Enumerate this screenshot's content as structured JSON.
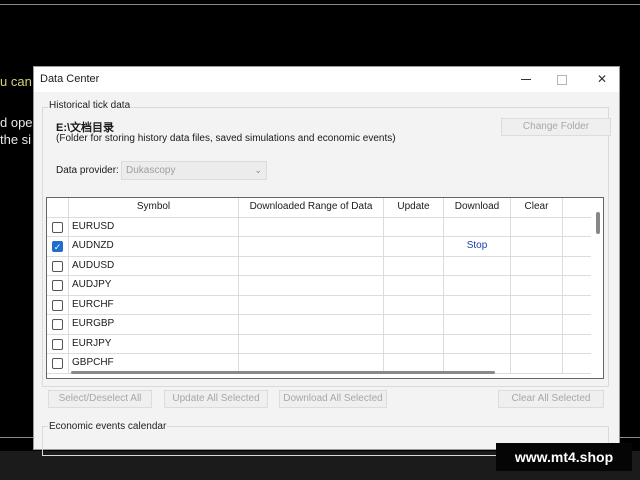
{
  "background": {
    "line1": "u can",
    "line2": "d ope",
    "line3": "the si"
  },
  "watermark": "www.mt4.shop",
  "window": {
    "title": "Data Center",
    "historical_group": "Historical tick data",
    "folder_path": "E:\\文档目录",
    "folder_description": "(Folder for storing history data files, saved simulations and economic events)",
    "change_folder_label": "Change Folder",
    "provider_label": "Data provider:",
    "provider_value": "Dukascopy",
    "table": {
      "columns": [
        "",
        "Symbol",
        "Downloaded Range of Data",
        "Update",
        "Download",
        "Clear",
        ""
      ],
      "rows": [
        {
          "checked": false,
          "symbol": "EURUSD",
          "range": "",
          "update": "",
          "download": "",
          "clear": ""
        },
        {
          "checked": true,
          "symbol": "AUDNZD",
          "range": "",
          "update": "",
          "download": "Stop",
          "clear": ""
        },
        {
          "checked": false,
          "symbol": "AUDUSD",
          "range": "",
          "update": "",
          "download": "",
          "clear": ""
        },
        {
          "checked": false,
          "symbol": "AUDJPY",
          "range": "",
          "update": "",
          "download": "",
          "clear": ""
        },
        {
          "checked": false,
          "symbol": "EURCHF",
          "range": "",
          "update": "",
          "download": "",
          "clear": ""
        },
        {
          "checked": false,
          "symbol": "EURGBP",
          "range": "",
          "update": "",
          "download": "",
          "clear": ""
        },
        {
          "checked": false,
          "symbol": "EURJPY",
          "range": "",
          "update": "",
          "download": "",
          "clear": ""
        },
        {
          "checked": false,
          "symbol": "GBPCHF",
          "range": "",
          "update": "",
          "download": "",
          "clear": ""
        }
      ]
    },
    "buttons": {
      "select_deselect": "Select/Deselect All",
      "update_all": "Update All Selected",
      "download_all": "Download All Selected",
      "clear_all": "Clear All Selected"
    },
    "economic_group": "Economic events calendar"
  },
  "colors": {
    "accent_checkbox": "#1f6dcc",
    "stop_link": "#1a3fa8",
    "bg_text": "#d6d17a"
  }
}
